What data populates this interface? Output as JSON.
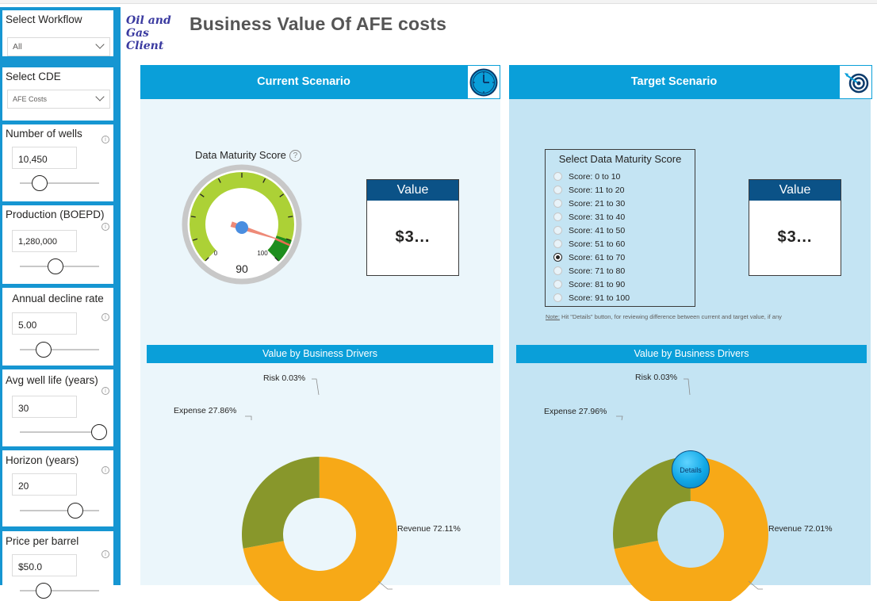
{
  "header": {
    "logo_text": "Oil and Gas Client",
    "title": "Business Value Of AFE costs"
  },
  "sidebar": {
    "workflow": {
      "label": "Select Workflow",
      "value": "All"
    },
    "cde": {
      "label": "Select CDE",
      "value": "AFE Costs"
    },
    "wells": {
      "label": "Number of wells",
      "value": "10,450",
      "slider_fraction": 0.25
    },
    "production": {
      "label": "Production (BOEPD)",
      "value": "1,280,000",
      "slider_fraction": 0.45
    },
    "decline": {
      "label": "Annual decline rate",
      "value": "5.00",
      "slider_fraction": 0.3
    },
    "well_life": {
      "label": "Avg well life (years)",
      "value": "30",
      "slider_fraction": 1.0
    },
    "horizon": {
      "label": "Horizon (years)",
      "value": "20",
      "slider_fraction": 0.7
    },
    "price": {
      "label": "Price per barrel",
      "value": "$50.0",
      "slider_fraction": 0.3
    }
  },
  "current": {
    "title": "Current Scenario",
    "icon": "clock-icon",
    "gauge": {
      "title": "Data Maturity Score",
      "help": "?",
      "min": 0,
      "max": 100,
      "min_label": "0",
      "max_label": "100",
      "value": 90,
      "value_label": "90",
      "target": 92
    },
    "value_card": {
      "label": "Value",
      "value": "$3..."
    },
    "drivers": {
      "title": "Value by Business Drivers",
      "labels": {
        "risk": "Risk 0.03%",
        "expense": "Expense 27.86%",
        "revenue": "Revenue 72.11%"
      }
    }
  },
  "target": {
    "title": "Target Scenario",
    "icon": "target-icon",
    "score_select": {
      "title": "Select Data Maturity Score",
      "options": [
        "Score: 0 to 10",
        "Score: 11 to 20",
        "Score: 21 to 30",
        "Score: 31 to 40",
        "Score: 41 to 50",
        "Score: 51 to 60",
        "Score: 61 to 70",
        "Score: 71 to 80",
        "Score: 81 to 90",
        "Score: 91 to 100"
      ],
      "selected_index": 6
    },
    "note_label": "Note:",
    "note": "Hit \"Details\" button, for reviewing difference between current and target value, if any",
    "value_card": {
      "label": "Value",
      "value": "$3..."
    },
    "drivers": {
      "title": "Value by Business Drivers",
      "labels": {
        "risk": "Risk 0.03%",
        "expense": "Expense 27.96%",
        "revenue": "Revenue 72.01%"
      },
      "details_button": "Details"
    }
  },
  "colors": {
    "sidebar": "#1696d2",
    "header_blue": "#0a9fd9",
    "revenue": "#f7a917",
    "expense": "#88972b",
    "gauge_fill": "#acd136",
    "gauge_good": "#1e8e1e",
    "value_header": "#0b5287"
  },
  "chart_data": [
    {
      "type": "pie",
      "title": "Value by Business Drivers",
      "categories": [
        "Revenue",
        "Expense",
        "Risk"
      ],
      "values": [
        72.11,
        27.86,
        0.03
      ]
    },
    {
      "type": "pie",
      "title": "Value by Business Drivers",
      "categories": [
        "Revenue",
        "Expense",
        "Risk"
      ],
      "values": [
        72.01,
        27.96,
        0.03
      ]
    }
  ]
}
